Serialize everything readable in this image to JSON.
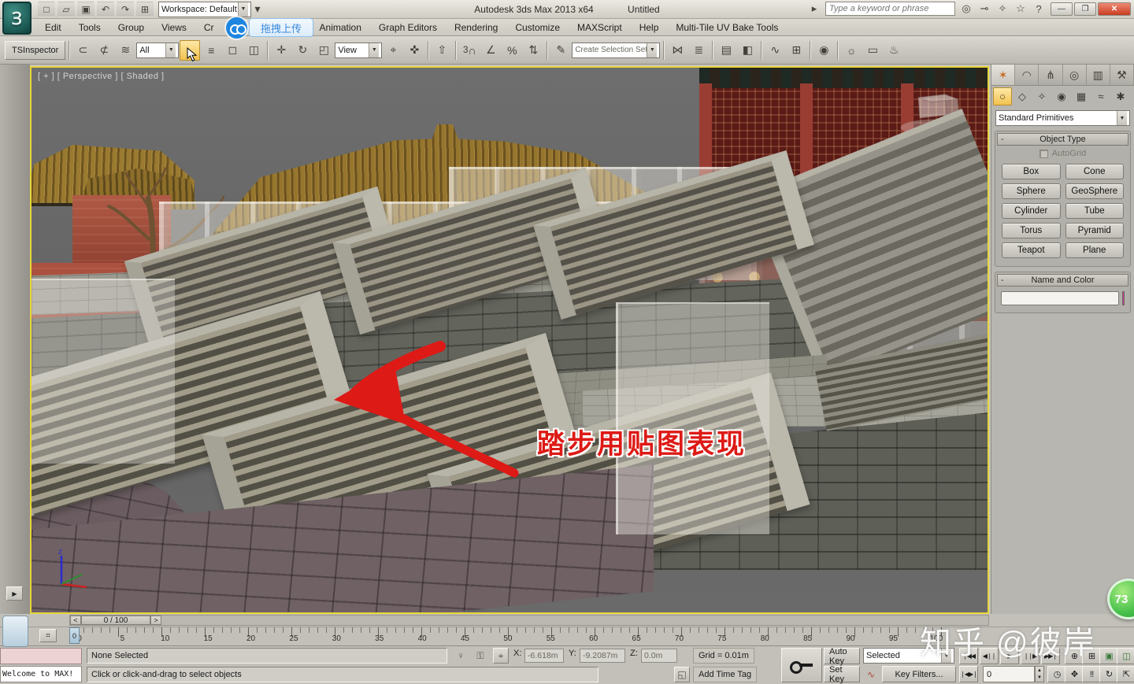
{
  "title_bar": {
    "workspace": "Workspace: Default",
    "app_title": "Autodesk 3ds Max  2013 x64",
    "doc_title": "Untitled",
    "search_placeholder": "Type a keyword or phrase"
  },
  "menu_bar": {
    "items": [
      "Edit",
      "Tools",
      "Group",
      "Views",
      "Cr",
      "Animation",
      "Graph Editors",
      "Rendering",
      "Customize",
      "MAXScript",
      "Help",
      "Multi-Tile UV Bake Tools"
    ],
    "upload_overlay_label": "拖拽上传"
  },
  "toolbar": {
    "tsinspector_label": "TSInspector",
    "selection_filter_value": "All",
    "coord_system_value": "View",
    "selection_set_placeholder": "Create Selection Set",
    "snaps_value": "3"
  },
  "viewport": {
    "label": "[ + ] [ Perspective ] [ Shaded ]",
    "annotation": "踏步用贴图表现",
    "axis_z_label": "z"
  },
  "command_panel": {
    "category_value": "Standard Primitives",
    "object_type": {
      "title": "Object Type",
      "collapse": "-",
      "autogrid_label": "AutoGrid",
      "buttons": [
        "Box",
        "Cone",
        "Sphere",
        "GeoSphere",
        "Cylinder",
        "Tube",
        "Torus",
        "Pyramid",
        "Teapot",
        "Plane"
      ]
    },
    "name_color": {
      "title": "Name and Color",
      "collapse": "-",
      "name_value": ""
    }
  },
  "timeline": {
    "slider_label": "0 / 100",
    "prev_label": "<",
    "next_label": ">",
    "thumb_value": "0",
    "ticks": [
      "0",
      "5",
      "10",
      "15",
      "20",
      "25",
      "30",
      "35",
      "40",
      "45",
      "50",
      "55",
      "60",
      "65",
      "70",
      "75",
      "80",
      "85",
      "90",
      "95",
      "100"
    ]
  },
  "status_bar": {
    "selection_status": "None Selected",
    "prompt": "Click or click-and-drag to select objects",
    "listener_text": "Welcome to MAX!",
    "x_label": "X:",
    "y_label": "Y:",
    "z_label": "Z:",
    "x_value": "-6.618m",
    "y_value": "-9.2087m",
    "z_value": "0.0m",
    "grid_label": "Grid = 0.01m",
    "add_time_tag": "Add Time Tag",
    "auto_key": "Auto Key",
    "set_key": "Set Key",
    "key_mode_value": "Selected",
    "key_filters": "Key Filters...",
    "frame_value": "0"
  },
  "overlays": {
    "watermark": "知乎 @彼岸",
    "badge": "73"
  },
  "colors": {
    "accent_yellow": "#e8d53a",
    "annotation_red": "#dd1a16",
    "swatch_magenta": "#d23c96",
    "overlay_blue": "#1f86e0"
  }
}
